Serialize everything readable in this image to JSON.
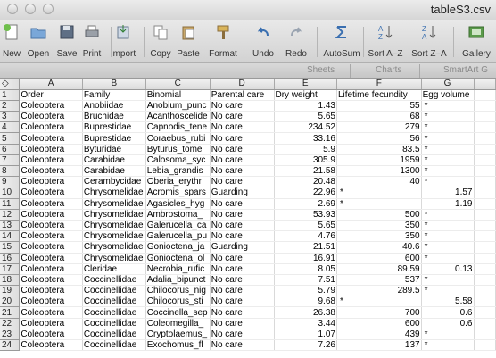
{
  "window": {
    "title": "tableS3.csv"
  },
  "toolbar": {
    "items": [
      {
        "label": "New",
        "icon": "new-document-icon"
      },
      {
        "label": "Open",
        "icon": "open-folder-icon"
      },
      {
        "label": "Save",
        "icon": "save-disk-icon"
      },
      {
        "label": "Print",
        "icon": "printer-icon"
      },
      {
        "label": "Import",
        "icon": "import-icon"
      },
      {
        "label": "Copy",
        "icon": "copy-icon"
      },
      {
        "label": "Paste",
        "icon": "paste-icon"
      },
      {
        "label": "Format",
        "icon": "format-brush-icon"
      },
      {
        "label": "Undo",
        "icon": "undo-icon"
      },
      {
        "label": "Redo",
        "icon": "redo-icon"
      },
      {
        "label": "AutoSum",
        "icon": "sigma-icon"
      },
      {
        "label": "Sort A–Z",
        "icon": "sort-ascending-icon"
      },
      {
        "label": "Sort Z–A",
        "icon": "sort-descending-icon"
      },
      {
        "label": "Gallery",
        "icon": "gallery-icon"
      }
    ]
  },
  "ribbon": {
    "tabs": [
      "Sheets",
      "Charts",
      "SmartArt G"
    ]
  },
  "grid": {
    "corner": "◇",
    "column_letters": [
      "A",
      "B",
      "C",
      "D",
      "E",
      "F",
      "G"
    ],
    "row_numbers": [
      "1",
      "2",
      "3",
      "4",
      "5",
      "6",
      "7",
      "8",
      "9",
      "10",
      "11",
      "12",
      "13",
      "14",
      "15",
      "16",
      "17",
      "18",
      "19",
      "20",
      "21",
      "22",
      "23",
      "24"
    ],
    "rows": [
      [
        "Order",
        "Family",
        "Binomial",
        "Parental care",
        "Dry weight",
        "Lifetime fecundity",
        "Egg volume"
      ],
      [
        "Coleoptera",
        "Anobiidae",
        "Anobium_punc",
        "No care",
        "1.43",
        "55",
        "*"
      ],
      [
        "Coleoptera",
        "Bruchidae",
        "Acanthoscelide",
        "No care",
        "5.65",
        "68",
        "*"
      ],
      [
        "Coleoptera",
        "Buprestidae",
        "Capnodis_tene",
        "No care",
        "234.52",
        "279",
        "*"
      ],
      [
        "Coleoptera",
        "Buprestidae",
        "Coraebus_rubi",
        "No care",
        "33.16",
        "56",
        "*"
      ],
      [
        "Coleoptera",
        "Byturidae",
        "Byturus_tome",
        "No care",
        "5.9",
        "83.5",
        "*"
      ],
      [
        "Coleoptera",
        "Carabidae",
        "Calosoma_syc",
        "No care",
        "305.9",
        "1959",
        "*"
      ],
      [
        "Coleoptera",
        "Carabidae",
        "Lebia_grandis",
        "No care",
        "21.58",
        "1300",
        "*"
      ],
      [
        "Coleoptera",
        "Cerambycidae",
        "Oberia_erythr",
        "No care",
        "20.48",
        "40",
        "*"
      ],
      [
        "Coleoptera",
        "Chrysomelidae",
        "Acromis_spars",
        "Guarding",
        "22.96",
        "*",
        "1.57"
      ],
      [
        "Coleoptera",
        "Chrysomelidae",
        "Agasicles_hyg",
        "No care",
        "2.69",
        "*",
        "1.19"
      ],
      [
        "Coleoptera",
        "Chrysomelidae",
        "Ambrostoma_",
        "No care",
        "53.93",
        "500",
        "*"
      ],
      [
        "Coleoptera",
        "Chrysomelidae",
        "Galerucella_ca",
        "No care",
        "5.65",
        "350",
        "*"
      ],
      [
        "Coleoptera",
        "Chrysomelidae",
        "Galerucella_pu",
        "No care",
        "4.76",
        "350",
        "*"
      ],
      [
        "Coleoptera",
        "Chrysomelidae",
        "Gonioctena_ja",
        "Guarding",
        "21.51",
        "40.6",
        "*"
      ],
      [
        "Coleoptera",
        "Chrysomelidae",
        "Gonioctena_ol",
        "No care",
        "16.91",
        "600",
        "*"
      ],
      [
        "Coleoptera",
        "Cleridae",
        "Necrobia_rufic",
        "No care",
        "8.05",
        "89.59",
        "0.13"
      ],
      [
        "Coleoptera",
        "Coccinellidae",
        "Adalia_bipunct",
        "No care",
        "7.51",
        "537",
        "*"
      ],
      [
        "Coleoptera",
        "Coccinellidae",
        "Chilocorus_nig",
        "No care",
        "5.79",
        "289.5",
        "*"
      ],
      [
        "Coleoptera",
        "Coccinellidae",
        "Chilocorus_sti",
        "No care",
        "9.68",
        "*",
        "5.58"
      ],
      [
        "Coleoptera",
        "Coccinellidae",
        "Coccinella_sep",
        "No care",
        "26.38",
        "700",
        "0.6"
      ],
      [
        "Coleoptera",
        "Coccinellidae",
        "Coleomegilla_",
        "No care",
        "3.44",
        "600",
        "0.6"
      ],
      [
        "Coleoptera",
        "Coccinellidae",
        "Cryptolaemus_",
        "No care",
        "1.07",
        "439",
        "*"
      ],
      [
        "Coleoptera",
        "Coccinellidae",
        "Exochomus_fl",
        "No care",
        "7.26",
        "137",
        "*"
      ]
    ]
  }
}
